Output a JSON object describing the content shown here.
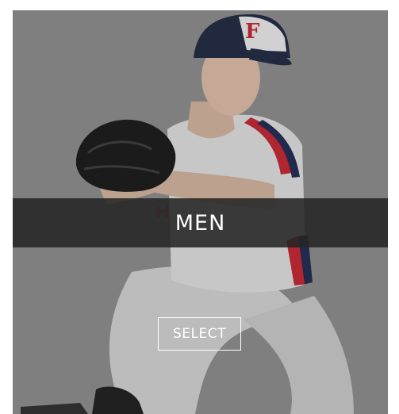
{
  "card": {
    "title": "MEN",
    "button_label": "SELECT",
    "image_alt": "baseball-pitcher-photo"
  },
  "colors": {
    "overlay": "#8c8c8c",
    "band": "#262626",
    "text": "#ffffff",
    "jersey_red": "#c8202e",
    "jersey_navy": "#1c2550"
  }
}
